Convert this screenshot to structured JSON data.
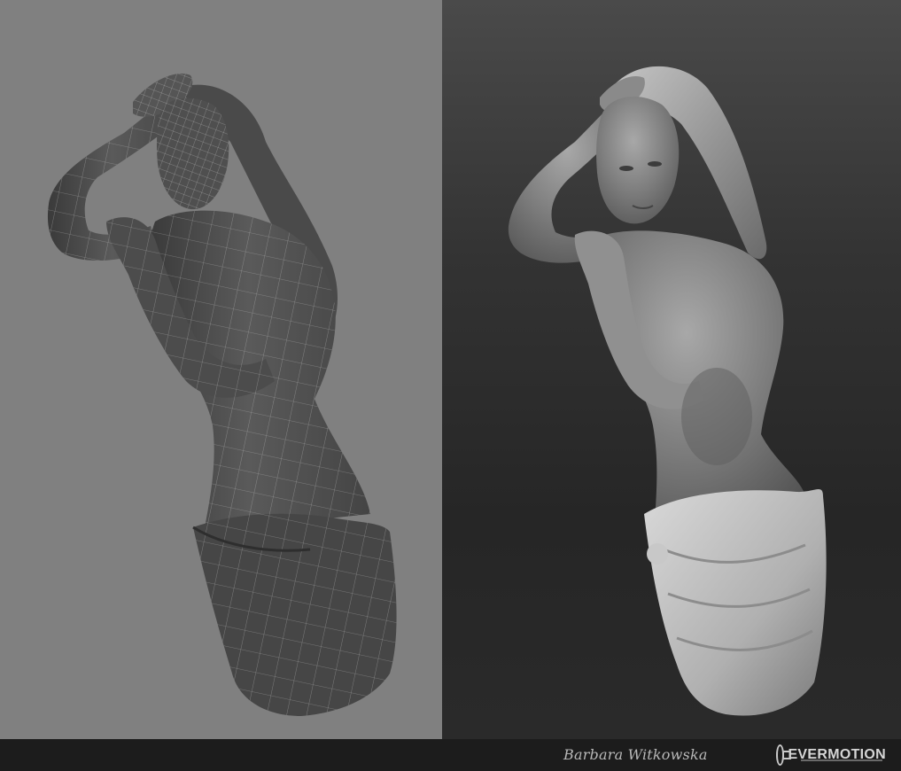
{
  "author": "Barbara Witkowska",
  "brand": {
    "name": "EVERMOTION",
    "icon": "evermotion-logo-icon"
  },
  "colors": {
    "left_bg": "#808080",
    "right_bg_top": "#4a4a4a",
    "right_bg_bottom": "#262626",
    "footer_bg": "#1c1c1c",
    "wire": "#d8d8d8"
  }
}
